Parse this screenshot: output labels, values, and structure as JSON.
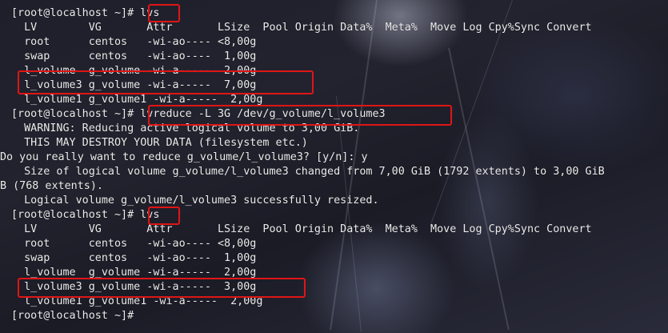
{
  "terminal": {
    "lines": [
      "[root@localhost ~]# lvs",
      "  LV        VG       Attr       LSize  Pool Origin Data%  Meta%  Move Log Cpy%Sync Convert",
      "  root      centos   -wi-ao---- <8,00g",
      "  swap      centos   -wi-ao----  1,00g",
      "  l_volume  g_volume -wi-a-----  2,00g",
      "  l_volume3 g_volume -wi-a-----  7,00g",
      "  l_volume1 g_volume1 -wi-a-----  2,00g",
      "[root@localhost ~]# lvreduce -L 3G /dev/g_volume/l_volume3",
      "  WARNING: Reducing active logical volume to 3,00 GiB.",
      "  THIS MAY DESTROY YOUR DATA (filesystem etc.)",
      "Do you really want to reduce g_volume/l_volume3? [y/n]: y",
      "  Size of logical volume g_volume/l_volume3 changed from 7,00 GiB (1792 extents) to 3,00 GiB",
      "B (768 extents).",
      "  Logical volume g_volume/l_volume3 successfully resized.",
      "[root@localhost ~]# lvs",
      "  LV        VG       Attr       LSize  Pool Origin Data%  Meta%  Move Log Cpy%Sync Convert",
      "  root      centos   -wi-ao---- <8,00g",
      "  swap      centos   -wi-ao----  1,00g",
      "  l_volume  g_volume -wi-a-----  2,00g",
      "  l_volume3 g_volume -wi-a-----  3,00g",
      "  l_volume1 g_volume1 -wi-a-----  2,00g",
      "[root@localhost ~]#"
    ]
  },
  "colors": {
    "highlight_border": "#e01515",
    "text": "#ececec"
  }
}
